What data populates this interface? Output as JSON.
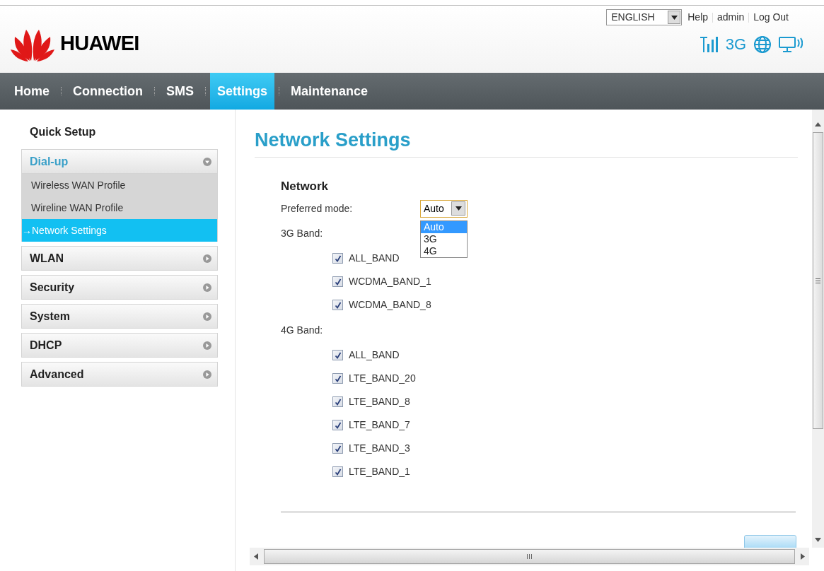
{
  "header": {
    "language": "ENGLISH",
    "links": [
      "Help",
      "admin",
      "Log Out"
    ],
    "logo": "HUAWEI",
    "network_type": "3G"
  },
  "nav": [
    {
      "label": "Home",
      "selected": false
    },
    {
      "label": "Connection",
      "selected": false
    },
    {
      "label": "SMS",
      "selected": false
    },
    {
      "label": "Settings",
      "selected": true
    },
    {
      "label": "Maintenance",
      "selected": false
    }
  ],
  "sidebar": {
    "quick_setup": "Quick Setup",
    "sections": [
      {
        "label": "Dial-up",
        "expanded": true,
        "children": [
          {
            "label": "Wireless WAN Profile",
            "selected": false
          },
          {
            "label": "Wireline WAN Profile",
            "selected": false
          },
          {
            "label": "→Network Settings",
            "selected": true
          }
        ]
      },
      {
        "label": "WLAN",
        "expanded": false
      },
      {
        "label": "Security",
        "expanded": false
      },
      {
        "label": "System",
        "expanded": false
      },
      {
        "label": "DHCP",
        "expanded": false
      },
      {
        "label": "Advanced",
        "expanded": false
      }
    ]
  },
  "page": {
    "title": "Network Settings",
    "section": "Network",
    "preferred_mode": {
      "label": "Preferred mode:",
      "value": "Auto",
      "open": true,
      "options": [
        {
          "label": "Auto",
          "selected": true
        },
        {
          "label": "3G",
          "selected": false
        },
        {
          "label": "4G",
          "selected": false
        }
      ]
    },
    "bands": [
      {
        "label": "3G Band:",
        "items": [
          {
            "label": "ALL_BAND",
            "checked": true
          },
          {
            "label": "WCDMA_BAND_1",
            "checked": true
          },
          {
            "label": "WCDMA_BAND_8",
            "checked": true
          }
        ]
      },
      {
        "label": "4G Band:",
        "items": [
          {
            "label": "ALL_BAND",
            "checked": true
          },
          {
            "label": "LTE_BAND_20",
            "checked": true
          },
          {
            "label": "LTE_BAND_8",
            "checked": true
          },
          {
            "label": "LTE_BAND_7",
            "checked": true
          },
          {
            "label": "LTE_BAND_3",
            "checked": true
          },
          {
            "label": "LTE_BAND_1",
            "checked": true
          }
        ]
      }
    ]
  }
}
